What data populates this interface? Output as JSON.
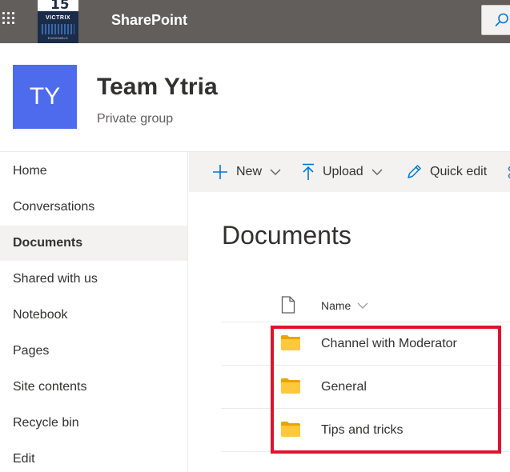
{
  "suite": {
    "app_name": "SharePoint",
    "logo": {
      "number": "15",
      "ans": "ANS",
      "wordmark": "VICTRIX",
      "tagline": "ENSEMBLE"
    }
  },
  "site": {
    "initials": "TY",
    "title": "Team Ytria",
    "subtitle": "Private group"
  },
  "nav": {
    "items": [
      {
        "label": "Home"
      },
      {
        "label": "Conversations"
      },
      {
        "label": "Documents",
        "selected": true
      },
      {
        "label": "Shared with us"
      },
      {
        "label": "Notebook"
      },
      {
        "label": "Pages"
      },
      {
        "label": "Site contents"
      },
      {
        "label": "Recycle bin"
      },
      {
        "label": "Edit"
      }
    ]
  },
  "commandbar": {
    "new_label": "New",
    "upload_label": "Upload",
    "quickedit_label": "Quick edit"
  },
  "library": {
    "title": "Documents",
    "column_name": "Name",
    "rows": [
      {
        "name": "Channel with Moderator"
      },
      {
        "name": "General"
      },
      {
        "name": "Tips and tricks"
      }
    ]
  },
  "colors": {
    "suitebar": "#625e5c",
    "site_logo": "#4f6bed",
    "accent": "#0078d4",
    "highlight": "#e0132d",
    "folder": "#ffb900"
  }
}
